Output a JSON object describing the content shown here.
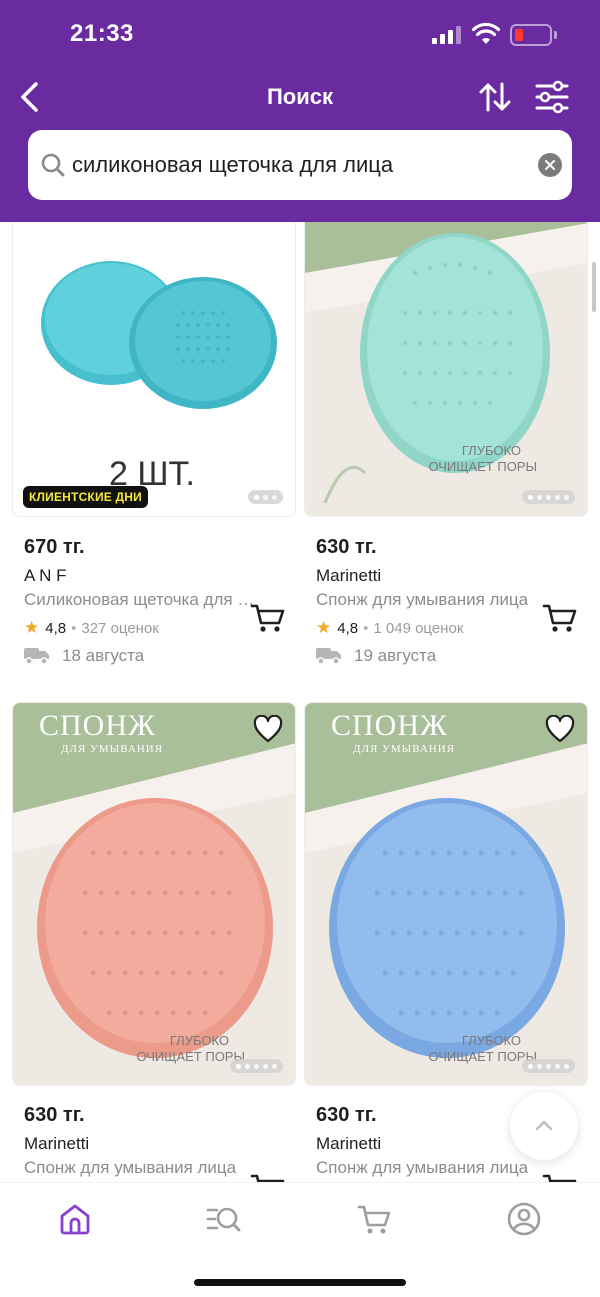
{
  "status_bar": {
    "time": "21:33"
  },
  "header": {
    "title": "Поиск"
  },
  "search": {
    "query": "силиконовая щеточка для лица"
  },
  "products": [
    {
      "price": "670 тг.",
      "brand": "A N F",
      "title": "Силиконовая щеточка для лица",
      "rating": "4,8",
      "reviews": "327 оценок",
      "delivery": "18 августа",
      "badge": "КЛИЕНТСКИЕ ДНИ",
      "image_caption": "2 ШТ.",
      "image_color": "#4cc3cf"
    },
    {
      "price": "630 тг.",
      "brand": "Marinetti",
      "title": "Спонж для умывания лица",
      "rating": "4,8",
      "reviews": "1 049 оценок",
      "delivery": "19 августа",
      "image_caption_1": "ГЛУБОКО",
      "image_caption_2": "ОЧИЩАЕТ ПОРЫ",
      "image_color": "#9fe0d6"
    },
    {
      "price": "630 тг.",
      "brand": "Marinetti",
      "title": "Спонж для умывания лица",
      "image_heading": "СПОНЖ",
      "image_subheading": "ДЛЯ УМЫВАНИЯ",
      "image_caption_1": "ГЛУБОКО",
      "image_caption_2": "ОЧИЩАЕТ ПОРЫ",
      "image_color": "#f1a091"
    },
    {
      "price": "630 тг.",
      "brand": "Marinetti",
      "title": "Спонж для умывания лица",
      "image_heading": "СПОНЖ",
      "image_subheading": "ДЛЯ УМЫВАНИЯ",
      "image_caption_1": "ГЛУБОКО",
      "image_caption_2": "ОЧИЩАЕТ ПОРЫ",
      "image_color": "#8fb7ea"
    }
  ],
  "bottom_nav": {
    "items": [
      {
        "icon": "home-icon",
        "active": true
      },
      {
        "icon": "catalog-search-icon",
        "active": false
      },
      {
        "icon": "cart-icon",
        "active": false
      },
      {
        "icon": "profile-icon",
        "active": false
      }
    ]
  },
  "colors": {
    "brand": "#6a2ba0",
    "accent": "#8a3fd0",
    "star": "#f5a623",
    "badge_text": "#f5e73a"
  }
}
